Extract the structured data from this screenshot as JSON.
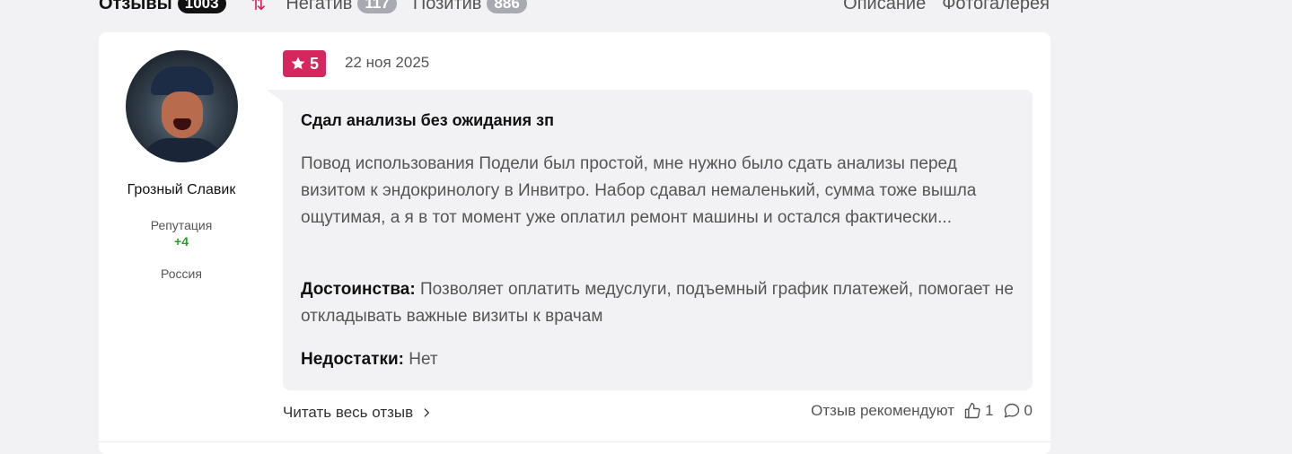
{
  "nav": {
    "tabs": [
      {
        "label": "Отзывы",
        "count": "1003"
      },
      {
        "label": "Негатив",
        "count": "117"
      },
      {
        "label": "Позитив",
        "count": "886"
      }
    ],
    "right_links": [
      "Описание",
      "Фотогалерея"
    ]
  },
  "review": {
    "author": {
      "name": "Грозный Славик",
      "reputation_label": "Репутация",
      "reputation_value": "+4",
      "country": "Россия"
    },
    "rating": "5",
    "date": "22 ноя 2025",
    "title": "Сдал анализы без ожидания зп",
    "text": "Повод использования Подели был простой, мне нужно было сдать анализы перед визитом к эндокринологу в Инвитро. Набор сдавал немаленький, сумма тоже вышла ощутимая, а я в тот момент уже оплатил ремонт машины и остался фактически...",
    "pros_label": "Достоинства:",
    "pros": "Позволяет оплатить медуслуги, подъемный график платежей, помогает не откладывать важные визиты к врачам",
    "cons_label": "Недостатки:",
    "cons": "Нет",
    "read_more": "Читать весь отзыв",
    "recommend_label": "Отзыв рекомендуют",
    "likes": "1",
    "comments": "0"
  },
  "colors": {
    "accent": "#d6265e",
    "reputation": "#2a9d2a",
    "bubble": "#f2f2f4"
  },
  "icons": [
    "sort-icon",
    "star-icon",
    "chevron-right-icon",
    "thumbs-up-icon",
    "comment-icon"
  ]
}
